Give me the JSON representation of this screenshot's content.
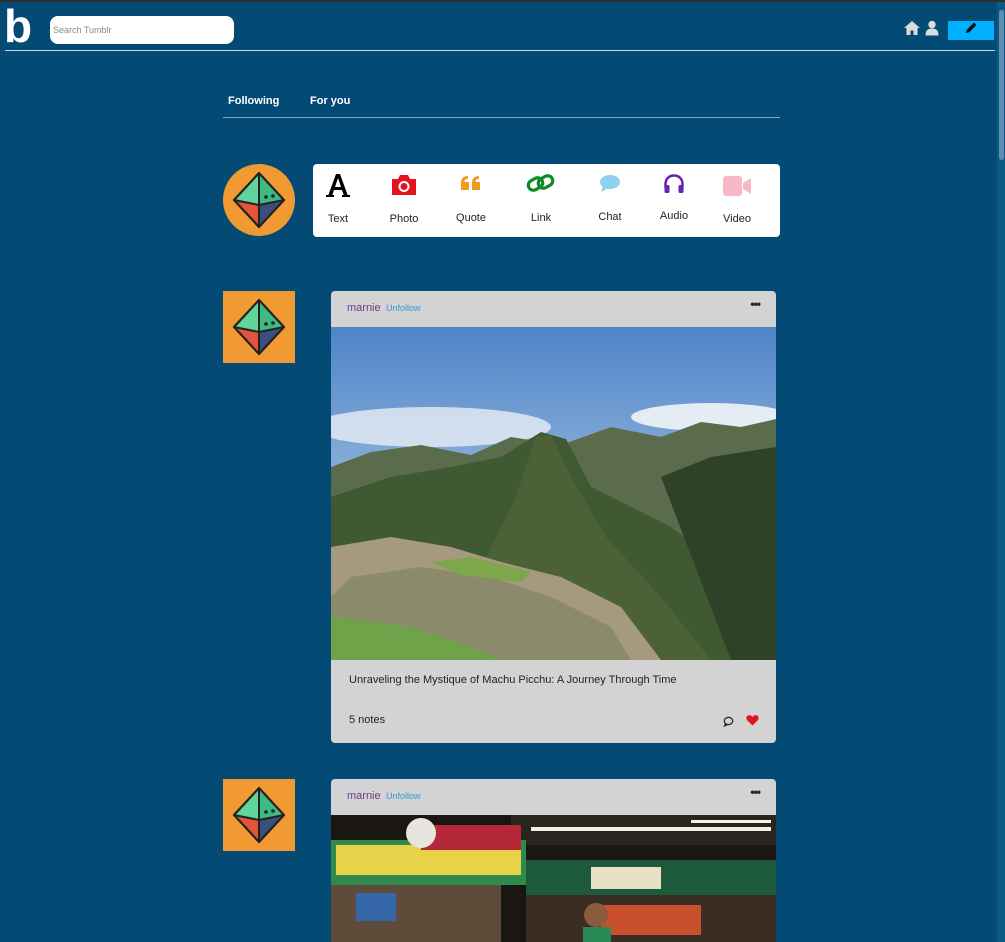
{
  "header": {
    "logo": "b",
    "search_placeholder": "Search Tumblr"
  },
  "tabs": [
    {
      "label": "Following"
    },
    {
      "label": "For you"
    }
  ],
  "composer": {
    "types": [
      {
        "label": "Text",
        "icon": "text-icon",
        "color": "#000000"
      },
      {
        "label": "Photo",
        "icon": "camera-icon",
        "color": "#e3141e"
      },
      {
        "label": "Quote",
        "icon": "quote-icon",
        "color": "#f29a1f"
      },
      {
        "label": "Link",
        "icon": "link-icon",
        "color": "#0f8a22"
      },
      {
        "label": "Chat",
        "icon": "chat-icon",
        "color": "#8fd1ee"
      },
      {
        "label": "Audio",
        "icon": "headphones-icon",
        "color": "#6a1fb8"
      },
      {
        "label": "Video",
        "icon": "video-icon",
        "color": "#f7b8c6"
      }
    ]
  },
  "posts": [
    {
      "username": "marnie",
      "follow_label": "Unfollow",
      "more": "•••",
      "caption": "Unraveling the Mystique of Machu Picchu: A Journey Through Time",
      "notes": "5 notes"
    },
    {
      "username": "marnie",
      "follow_label": "Unfollow",
      "more": "•••"
    }
  ],
  "colors": {
    "background": "#034a75",
    "avatar": "#f19a33",
    "compose_button": "#00b0ff",
    "liked": "#e3141e"
  }
}
